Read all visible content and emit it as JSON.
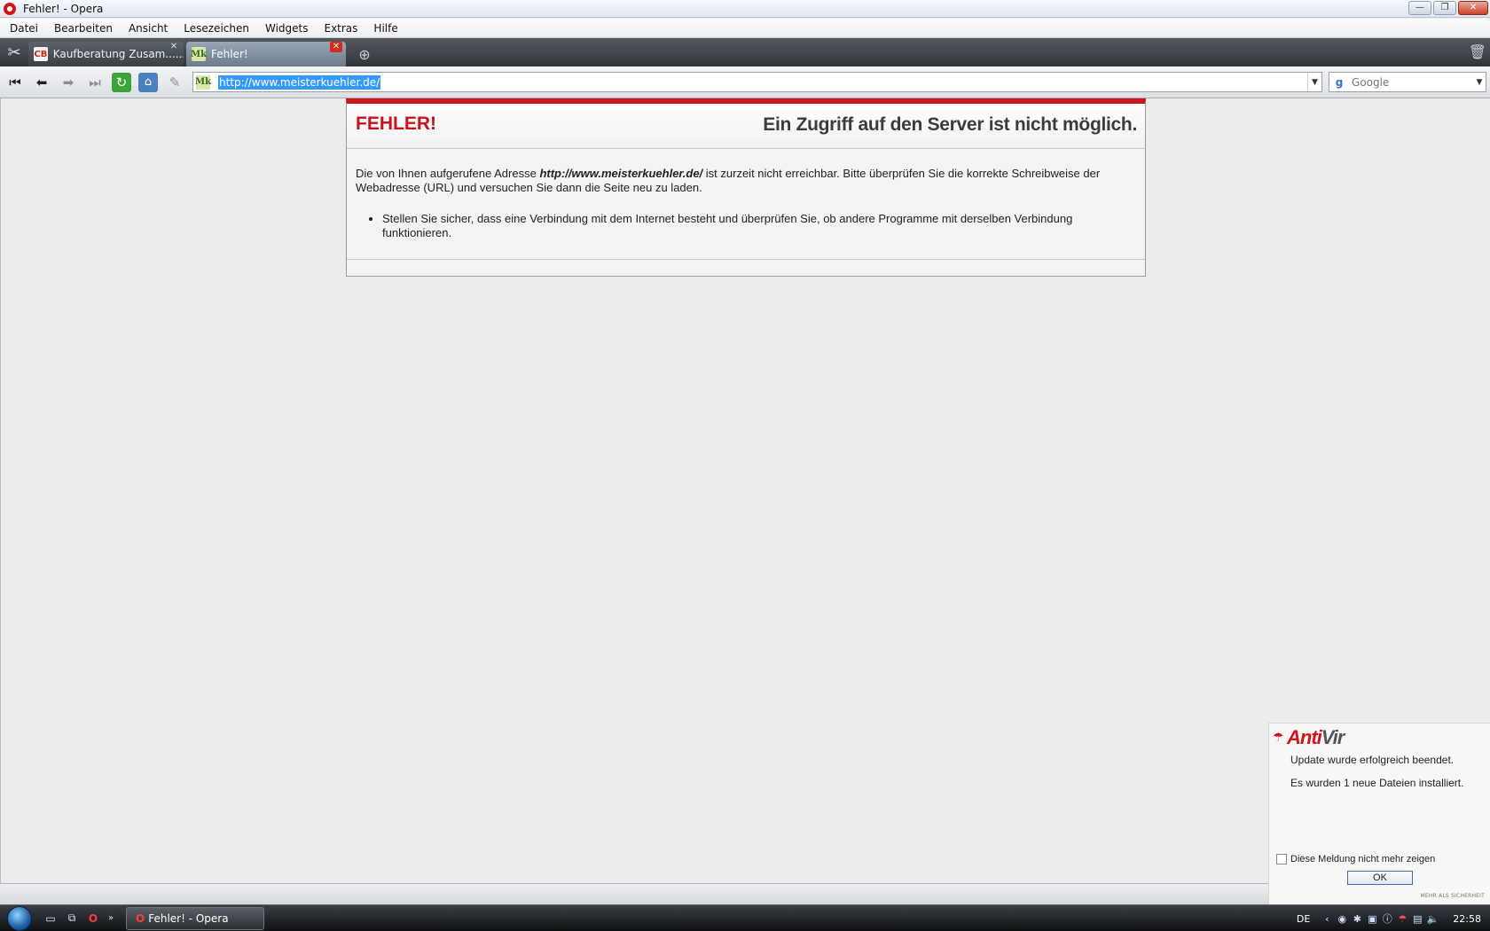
{
  "window": {
    "title": "Fehler! - Opera",
    "minimize": "—",
    "maximize": "❐",
    "close": "✕"
  },
  "menu": [
    "Datei",
    "Bearbeiten",
    "Ansicht",
    "Lesezeichen",
    "Widgets",
    "Extras",
    "Hilfe"
  ],
  "tabs": [
    {
      "label": "Kaufberatung Zusam......",
      "favicon": "CB",
      "active": false
    },
    {
      "label": "Fehler!",
      "favicon": "Mk",
      "active": true
    }
  ],
  "address": {
    "url": "http://www.meisterkuehler.de/",
    "favicon": "Mk"
  },
  "search": {
    "placeholder": "Google",
    "icon": "g"
  },
  "error": {
    "title": "FEHLER!",
    "subtitle": "Ein Zugriff auf den Server ist nicht möglich.",
    "text_before": "Die von Ihnen aufgerufene Adresse ",
    "url": "http://www.meisterkuehler.de/",
    "text_after": " ist zurzeit nicht erreichbar. Bitte überprüfen Sie die korrekte Schreibweise der Webadresse (URL) und versuchen Sie dann die Seite neu zu laden.",
    "bullets": [
      "Stellen Sie sicher, dass eine Verbindung mit dem Internet besteht und überprüfen Sie, ob andere Programme mit derselben Verbindung funktionieren."
    ]
  },
  "antivir": {
    "brand_part1": "Anti",
    "brand_part2": "Vir",
    "msg1": "Update wurde erfolgreich beendet.",
    "msg2": "Es wurden 1 neue Dateien installiert.",
    "checkbox_label": "Diese Meldung nicht mehr zeigen",
    "ok_label": "OK",
    "tagline": "MEHR ALS SICHERHEIT"
  },
  "taskbar": {
    "task_label": "Fehler! - Opera",
    "language": "DE",
    "clock": "22:58"
  },
  "colors": {
    "error_red": "#c8121c",
    "accent_red": "#d0141e",
    "selection_blue": "#3399ff"
  }
}
